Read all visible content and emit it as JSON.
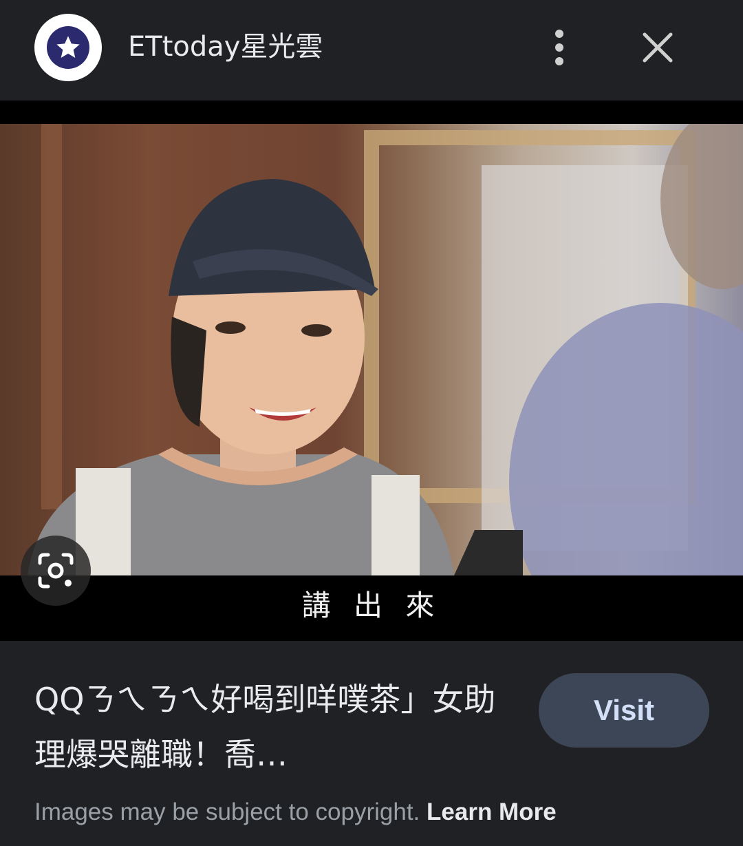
{
  "header": {
    "site_name": "ETtoday星光雲",
    "logo_icon": "star-icon",
    "more_icon": "more-vert-icon",
    "close_icon": "close-icon"
  },
  "image": {
    "subtitle": "講 出 來",
    "lens_icon": "lens-search-icon"
  },
  "result": {
    "title": "QQㄋㄟㄋㄟ好喝到咩噗茶」女助理爆哭離職！喬…",
    "visit_label": "Visit"
  },
  "footer": {
    "copyright_text": "Images may be subject to copyright.",
    "learn_more_label": "Learn More"
  },
  "colors": {
    "background": "#202124",
    "logo_bg": "#2b2a6e",
    "visit_bg": "#3c4657",
    "visit_text": "#d4e0f7"
  }
}
